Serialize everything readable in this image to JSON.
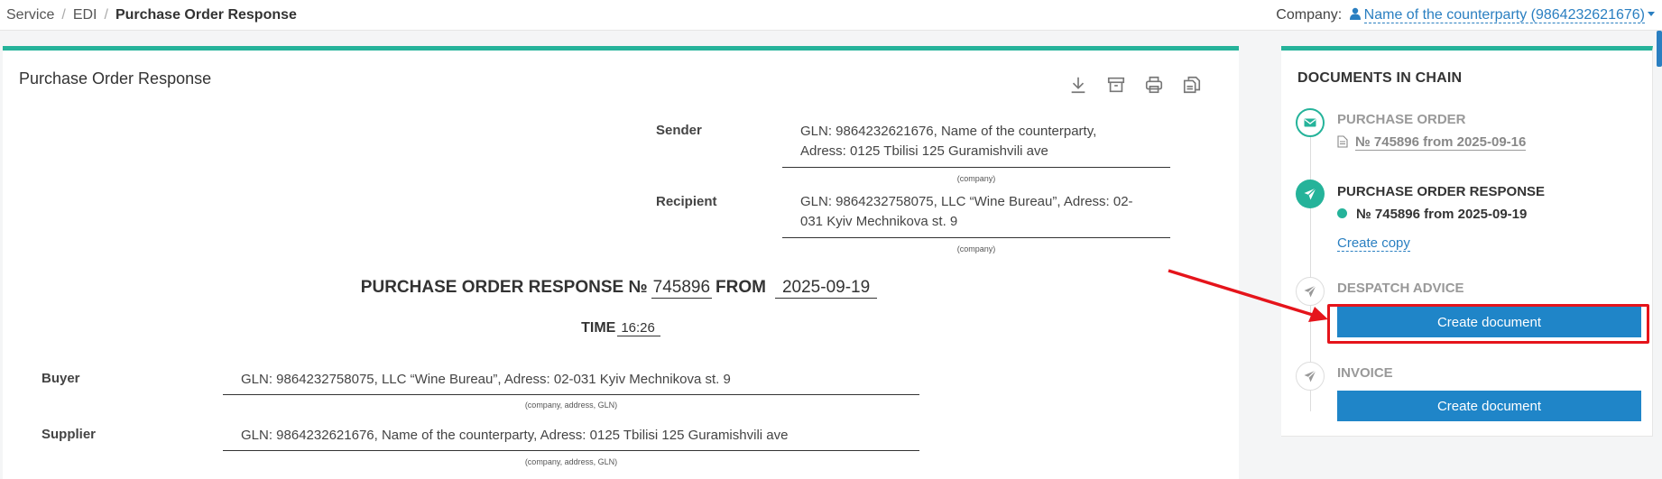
{
  "breadcrumb": {
    "item1": "Service",
    "item2": "EDI",
    "current": "Purchase Order Response",
    "sep": "/"
  },
  "company": {
    "label": "Company:",
    "value": "Name of the counterparty (9864232621676)"
  },
  "main": {
    "title": "Purchase Order Response",
    "toolbar": [
      "download-icon",
      "archive-icon",
      "print-icon",
      "copy-icon"
    ],
    "sender": {
      "label": "Sender",
      "line1": "GLN: 9864232621676, Name of the counterparty,",
      "line2": "Adress: 0125 Tbilisi 125 Guramishvili ave",
      "hint": "(company)"
    },
    "recipient": {
      "label": "Recipient",
      "line1": "GLN: 9864232758075, LLC “Wine Bureau”, Adress: 02-",
      "line2": "031 Kyiv Mechnikova st. 9",
      "hint": "(company)"
    },
    "heading": {
      "prefix": "PURCHASE ORDER RESPONSE №",
      "number": "745896",
      "from_label": "FROM",
      "date": "2025-09-19"
    },
    "time": {
      "label": "TIME",
      "value": "16:26"
    },
    "buyer": {
      "label": "Buyer",
      "value": "GLN: 9864232758075, LLC “Wine Bureau”, Adress: 02-031 Kyiv Mechnikova st. 9",
      "hint": "(company, address, GLN)"
    },
    "supplier": {
      "label": "Supplier",
      "value": "GLN: 9864232621676, Name of the counterparty, Adress: 0125 Tbilisi 125 Guramishvili ave",
      "hint": "(company, address, GLN)"
    }
  },
  "chain": {
    "title": "DOCUMENTS IN CHAIN",
    "purchase_order": {
      "name": "PURCHASE ORDER",
      "link": "№ 745896 from 2025-09-16"
    },
    "purchase_order_response": {
      "name": "PURCHASE ORDER RESPONSE",
      "doc": "№ 745896 from 2025-09-19",
      "create_copy": "Create copy"
    },
    "despatch_advice": {
      "name": "DESPATCH ADVICE",
      "button": "Create document"
    },
    "invoice": {
      "name": "INVOICE",
      "button": "Create document"
    }
  },
  "colors": {
    "accent": "#25b39a",
    "primary": "#1f85c8",
    "highlight": "#e5141b"
  }
}
